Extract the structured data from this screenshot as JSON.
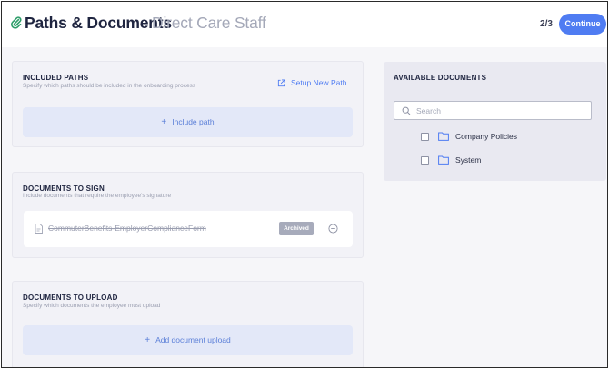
{
  "header": {
    "title": "Paths & Documents",
    "subtitle": "Direct Care Staff",
    "step": "2/3",
    "continue_label": "Continue"
  },
  "included_paths": {
    "title": "INCLUDED PATHS",
    "description": "Specify which paths should be included in the onboarding process",
    "setup_label": "Setup New Path",
    "include_label": "Include path"
  },
  "documents_to_sign": {
    "title": "DOCUMENTS TO SIGN",
    "description": "Include documents that require the employee's signature",
    "items": [
      {
        "name": "CommuterBenefits-EmployerComplianceForm",
        "status": "Archived"
      }
    ]
  },
  "documents_to_upload": {
    "title": "DOCUMENTS TO UPLOAD",
    "description": "Specify which documents the employee must upload",
    "add_label": "Add document upload"
  },
  "available_documents": {
    "title": "AVAILABLE DOCUMENTS",
    "search_placeholder": "Search",
    "folders": [
      {
        "label": "Company Policies",
        "checked": false
      },
      {
        "label": "System",
        "checked": false
      }
    ]
  },
  "colors": {
    "accent": "#4f7cf2",
    "background": "#f6f6f9",
    "archived_badge": "#a7abbb"
  }
}
